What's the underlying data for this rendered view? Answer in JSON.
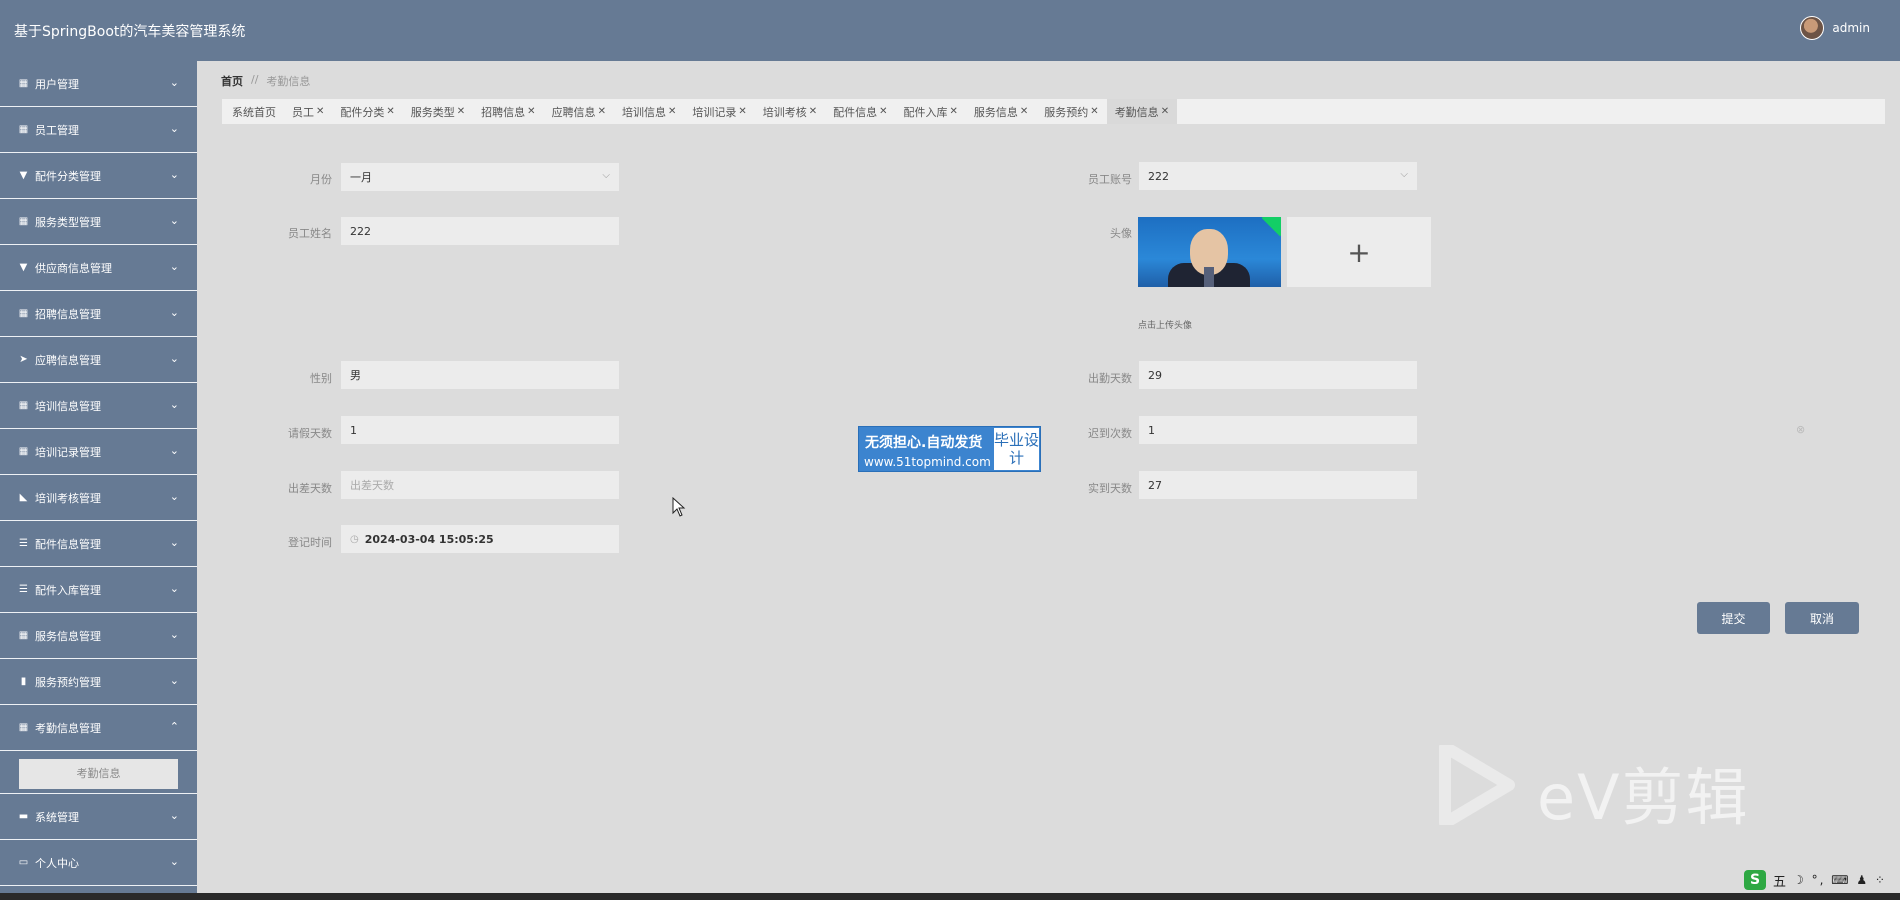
{
  "app": {
    "title": "基于SpringBoot的汽车美容管理系统",
    "user_name": "admin"
  },
  "sidebar": {
    "items": [
      {
        "label": "用户管理",
        "icon": "grid-icon",
        "arrow": "⌄"
      },
      {
        "label": "员工管理",
        "icon": "grid-icon",
        "arrow": "⌄"
      },
      {
        "label": "配件分类管理",
        "icon": "comment-icon",
        "arrow": "⌄"
      },
      {
        "label": "服务类型管理",
        "icon": "grid-icon",
        "arrow": "⌄"
      },
      {
        "label": "供应商信息管理",
        "icon": "comment-icon",
        "arrow": "⌄"
      },
      {
        "label": "招聘信息管理",
        "icon": "table-icon",
        "arrow": "⌄"
      },
      {
        "label": "应聘信息管理",
        "icon": "send-icon",
        "arrow": "⌄"
      },
      {
        "label": "培训信息管理",
        "icon": "grid-icon",
        "arrow": "⌄"
      },
      {
        "label": "培训记录管理",
        "icon": "grid-icon",
        "arrow": "⌄"
      },
      {
        "label": "培训考核管理",
        "icon": "thumb-icon",
        "arrow": "⌄"
      },
      {
        "label": "配件信息管理",
        "icon": "list-icon",
        "arrow": "⌄"
      },
      {
        "label": "配件入库管理",
        "icon": "list-icon",
        "arrow": "⌄"
      },
      {
        "label": "服务信息管理",
        "icon": "grid-icon",
        "arrow": "⌄"
      },
      {
        "label": "服务预约管理",
        "icon": "bar-chart-icon",
        "arrow": "⌄"
      },
      {
        "label": "考勤信息管理",
        "icon": "grid-icon",
        "arrow": "⌃"
      }
    ],
    "submenu_item": "考勤信息",
    "after_items": [
      {
        "label": "系统管理",
        "icon": "briefcase-icon",
        "arrow": "⌄"
      },
      {
        "label": "个人中心",
        "icon": "window-icon",
        "arrow": "⌄"
      }
    ]
  },
  "breadcrumb": {
    "home": "首页",
    "separator": "//",
    "current": "考勤信息"
  },
  "tabs": [
    {
      "label": "系统首页",
      "closable": false
    },
    {
      "label": "员工",
      "closable": true
    },
    {
      "label": "配件分类",
      "closable": true
    },
    {
      "label": "服务类型",
      "closable": true
    },
    {
      "label": "招聘信息",
      "closable": true
    },
    {
      "label": "应聘信息",
      "closable": true
    },
    {
      "label": "培训信息",
      "closable": true
    },
    {
      "label": "培训记录",
      "closable": true
    },
    {
      "label": "培训考核",
      "closable": true
    },
    {
      "label": "配件信息",
      "closable": true
    },
    {
      "label": "配件入库",
      "closable": true
    },
    {
      "label": "服务信息",
      "closable": true
    },
    {
      "label": "服务预约",
      "closable": true
    },
    {
      "label": "考勤信息",
      "closable": true,
      "active": true
    }
  ],
  "form": {
    "month_label": "月份",
    "month_value": "一月",
    "employee_account_label": "员工账号",
    "employee_account_value": "222",
    "employee_name_label": "员工姓名",
    "employee_name_value": "222",
    "avatar_label": "头像",
    "upload_plus": "+",
    "upload_tip": "点击上传头像",
    "gender_label": "性别",
    "gender_value": "男",
    "attendance_days_label": "出勤天数",
    "attendance_days_value": "29",
    "leave_days_label": "请假天数",
    "leave_days_value": "1",
    "late_count_label": "迟到次数",
    "late_count_value": "1",
    "business_trip_label": "出差天数",
    "business_trip_placeholder": "出差天数",
    "actual_days_label": "实到天数",
    "actual_days_value": "27",
    "register_time_label": "登记时间",
    "register_time_value": "2024-03-04 15:05:25",
    "submit_label": "提交",
    "cancel_label": "取消"
  },
  "overlay": {
    "promo_line1": "无须担心.自动发货",
    "promo_line2": "www.51topmind.com",
    "promo_side": "毕业设计",
    "watermark": "eV剪辑"
  },
  "tray": {
    "ime": "S",
    "ime_mode": "五",
    "symbols": "☽ °, ⌨ ♟ ⁘"
  },
  "colors": {
    "sidebar_bg": "#667a94",
    "topbar_bg": "#667a94",
    "content_bg": "#dcdcdc",
    "button_bg": "#667a94"
  }
}
